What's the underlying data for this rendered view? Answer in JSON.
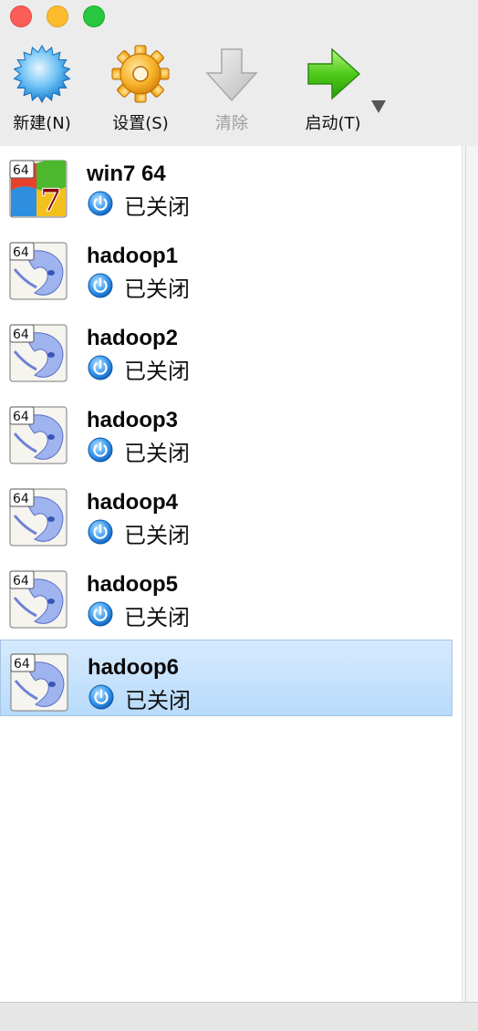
{
  "window": {
    "controls": [
      "close",
      "minimize",
      "zoom"
    ]
  },
  "toolbar": {
    "new_label": "新建(N)",
    "settings_label": "设置(S)",
    "discard_label": "清除",
    "start_label": "启动(T)",
    "icons": {
      "new": "starburst-icon",
      "settings": "gear-icon",
      "discard": "down-arrow-icon",
      "start": "right-arrow-icon"
    }
  },
  "vms": [
    {
      "name": "win7 64",
      "state": "已关闭",
      "badge": "64",
      "os_icon": "windows7-icon",
      "selected": false
    },
    {
      "name": "hadoop1",
      "state": "已关闭",
      "badge": "64",
      "os_icon": "linux-generic-icon",
      "selected": false
    },
    {
      "name": "hadoop2",
      "state": "已关闭",
      "badge": "64",
      "os_icon": "linux-generic-icon",
      "selected": false
    },
    {
      "name": "hadoop3",
      "state": "已关闭",
      "badge": "64",
      "os_icon": "linux-generic-icon",
      "selected": false
    },
    {
      "name": "hadoop4",
      "state": "已关闭",
      "badge": "64",
      "os_icon": "linux-generic-icon",
      "selected": false
    },
    {
      "name": "hadoop5",
      "state": "已关闭",
      "badge": "64",
      "os_icon": "linux-generic-icon",
      "selected": false
    },
    {
      "name": "hadoop6",
      "state": "已关闭",
      "badge": "64",
      "os_icon": "linux-generic-icon",
      "selected": true
    }
  ],
  "colors": {
    "selection": "#c4e1fc",
    "power_icon": "#2a8ee8"
  }
}
